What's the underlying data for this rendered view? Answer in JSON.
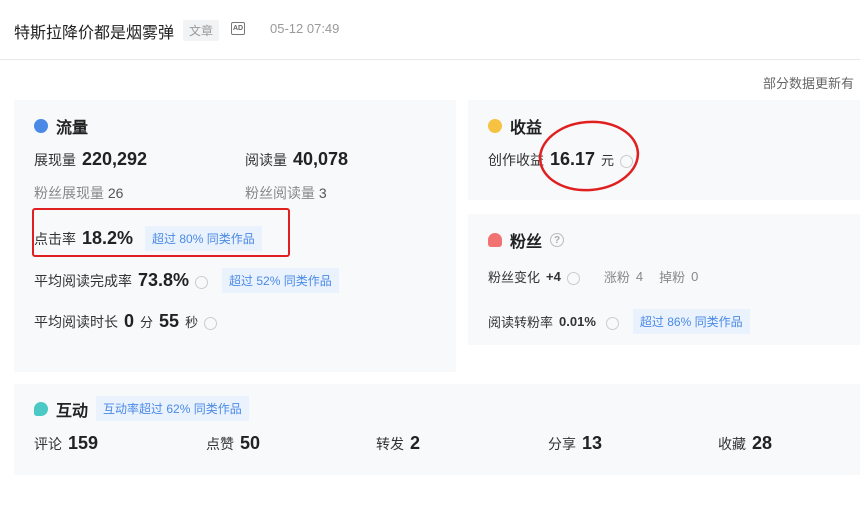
{
  "header": {
    "title": "特斯拉降价都是烟雾弹",
    "type_tag": "文章",
    "ad_label": "AD",
    "time": "05-12 07:49"
  },
  "notice": "部分数据更新有",
  "traffic": {
    "title": "流量",
    "impressions_label": "展现量",
    "impressions": "220,292",
    "reads_label": "阅读量",
    "reads": "40,078",
    "fan_impr_label": "粉丝展现量",
    "fan_impr": "26",
    "fan_reads_label": "粉丝阅读量",
    "fan_reads": "3",
    "ctr_label": "点击率",
    "ctr": "18.2%",
    "ctr_badge": "超过 80% 同类作品",
    "completion_label": "平均阅读完成率",
    "completion": "73.8%",
    "completion_badge": "超过 52% 同类作品",
    "duration_label": "平均阅读时长",
    "duration_min": "0",
    "min_unit": "分",
    "duration_sec": "55",
    "sec_unit": "秒"
  },
  "income": {
    "title": "收益",
    "label": "创作收益",
    "value": "16.17",
    "unit": "元"
  },
  "fans": {
    "title": "粉丝",
    "change_label": "粉丝变化",
    "change": "+4",
    "gain_label": "涨粉",
    "gain": "4",
    "loss_label": "掉粉",
    "loss": "0",
    "conv_label": "阅读转粉率",
    "conv": "0.01%",
    "conv_badge": "超过 86% 同类作品"
  },
  "interaction": {
    "title": "互动",
    "badge": "互动率超过 62% 同类作品",
    "items": [
      {
        "label": "评论",
        "value": "159"
      },
      {
        "label": "点赞",
        "value": "50"
      },
      {
        "label": "转发",
        "value": "2"
      },
      {
        "label": "分享",
        "value": "13"
      },
      {
        "label": "收藏",
        "value": "28"
      }
    ]
  },
  "colors": {
    "annotation": "#e02020",
    "badge_text": "#4a8ae6"
  }
}
